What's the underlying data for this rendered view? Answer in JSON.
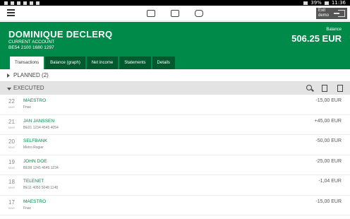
{
  "statusbar": {
    "battery": "39%",
    "time": "11:36"
  },
  "topbar": {
    "exit_label": "Exit demo"
  },
  "account": {
    "holder": "DOMINIQUE DECLERQ",
    "type": "CURRENT ACCOUNT",
    "iban": "BE54 2100 1680 1297",
    "balance_label": "Balance",
    "balance_value": "506.25 EUR"
  },
  "tabs": [
    "Transactions",
    "Balance (graph)",
    "Net income",
    "Statements",
    "Details"
  ],
  "planned": {
    "label": "PLANNED",
    "count": "(2)"
  },
  "executed": {
    "label": "EXECUTED"
  },
  "transactions": [
    {
      "day": "22",
      "month": "MAR",
      "counterparty": "MAESTRO",
      "detail": "Fnac",
      "amount": "-15,00 EUR"
    },
    {
      "day": "21",
      "month": "MAR",
      "counterparty": "JAN JANSSEN",
      "detail": "BE01 1234 4545 4054",
      "amount": "+45,00 EUR"
    },
    {
      "day": "20",
      "month": "MAR",
      "counterparty": "SELFBANK",
      "detail": "Metro Rogier",
      "amount": "-50,00 EUR"
    },
    {
      "day": "19",
      "month": "MAR",
      "counterparty": "JOHN DOE",
      "detail": "BE98 1245 4645 1234",
      "amount": "-25,00 EUR"
    },
    {
      "day": "18",
      "month": "MAR",
      "counterparty": "TELENET",
      "detail": "BE11 4050 5048 1148",
      "amount": "-1,04 EUR"
    },
    {
      "day": "17",
      "month": "MAR",
      "counterparty": "MAESTRO",
      "detail": "Fnac",
      "amount": "-15,00 EUR"
    }
  ],
  "colors": {
    "brand": "#008a4a",
    "brand_dark": "#005a2e"
  }
}
